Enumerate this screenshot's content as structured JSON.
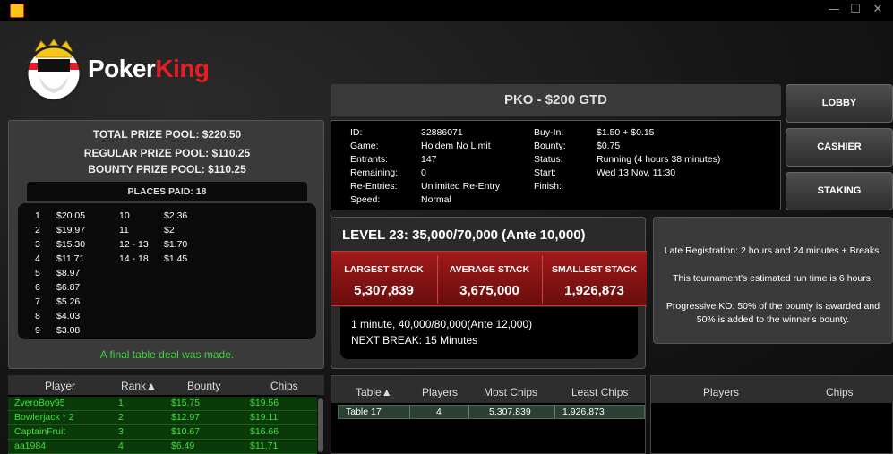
{
  "window": {
    "controls": [
      "—",
      "☐",
      "✕"
    ]
  },
  "logo": {
    "part1": "Poker",
    "part2": "King"
  },
  "prize": {
    "total": "TOTAL PRIZE POOL: $220.50",
    "regular": "REGULAR PRIZE POOL: $110.25",
    "bounty": "BOUNTY PRIZE POOL: $110.25",
    "places_paid": "PLACES PAID: 18",
    "places_left": [
      {
        "pos": "1",
        "amt": "$20.05"
      },
      {
        "pos": "2",
        "amt": "$19.97"
      },
      {
        "pos": "3",
        "amt": "$15.30"
      },
      {
        "pos": "4",
        "amt": "$11.71"
      },
      {
        "pos": "5",
        "amt": "$8.97"
      },
      {
        "pos": "6",
        "amt": "$6.87"
      },
      {
        "pos": "7",
        "amt": "$5.26"
      },
      {
        "pos": "8",
        "amt": "$4.03"
      },
      {
        "pos": "9",
        "amt": "$3.08"
      }
    ],
    "places_right": [
      {
        "pos": "10",
        "amt": "$2.36"
      },
      {
        "pos": "11",
        "amt": "$2"
      },
      {
        "pos": "12 - 13",
        "amt": "$1.70"
      },
      {
        "pos": "14 - 18",
        "amt": "$1.45"
      }
    ],
    "deal_message": "A final table deal was made."
  },
  "players": {
    "headers": {
      "player": "Player",
      "rank": "Rank▲",
      "bounty": "Bounty",
      "chips": "Chips"
    },
    "rows": [
      {
        "player": "ZveroBoy95",
        "rank": "1",
        "bounty": "$15.75",
        "chips": "$19.56"
      },
      {
        "player": "Bowlerjack * 2",
        "rank": "2",
        "bounty": "$12.97",
        "chips": "$19.11"
      },
      {
        "player": "CaptainFruit",
        "rank": "3",
        "bounty": "$10.67",
        "chips": "$16.66"
      },
      {
        "player": "aa1984",
        "rank": "4",
        "bounty": "$6.49",
        "chips": "$11.71"
      }
    ]
  },
  "tournament": {
    "title": "PKO - $200 GTD",
    "left_labels": [
      "ID:",
      "Game:",
      "Entrants:",
      "Remaining:",
      "Re-Entries:",
      "Speed:"
    ],
    "left_values": [
      "32886071",
      "Holdem No Limit",
      "147",
      "0",
      "Unlimited Re-Entry",
      "Normal"
    ],
    "right_labels": [
      "Buy-In:",
      "Bounty:",
      "Status:",
      "Start:",
      "Finish:"
    ],
    "right_values": [
      "$1.50 + $0.15",
      "$0.75",
      "Running (4 hours 38 minutes)",
      "Wed 13 Nov, 11:30",
      ""
    ]
  },
  "buttons": {
    "lobby": "LOBBY",
    "cashier": "CASHIER",
    "staking": "STAKING"
  },
  "level": {
    "title": "LEVEL 23: 35,000/70,000 (Ante 10,000)",
    "largest_label": "LARGEST STACK",
    "largest_value": "5,307,839",
    "average_label": "AVERAGE STACK",
    "average_value": "3,675,000",
    "smallest_label": "SMALLEST STACK",
    "smallest_value": "1,926,873",
    "next_level": "1 minute, 40,000/80,000(Ante 12,000)",
    "next_break": "NEXT BREAK: 15 Minutes"
  },
  "notes": {
    "late_reg": "Late Registration: 2 hours and 24 minutes + Breaks.",
    "run_time": "This tournament's estimated run time is 6 hours.",
    "pko_line1": "Progressive KO: 50% of the bounty is awarded and",
    "pko_line2": "50% is added to the winner's bounty."
  },
  "tables": {
    "headers": {
      "table": "Table▲",
      "players": "Players",
      "most": "Most Chips",
      "least": "Least Chips"
    },
    "row": {
      "table": "Table 17",
      "players": "4",
      "most": "5,307,839",
      "least": "1,926,873"
    }
  },
  "table_players": {
    "headers": {
      "players": "Players",
      "chips": "Chips"
    }
  }
}
